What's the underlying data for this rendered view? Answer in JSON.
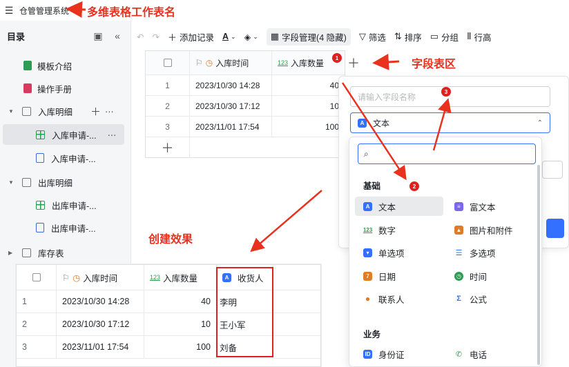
{
  "topbar": {
    "app_title": "仓管管理系统",
    "annotation": "多维表格工作表名"
  },
  "sidebar": {
    "title": "目录",
    "items": [
      {
        "label": "模板介绍"
      },
      {
        "label": "操作手册"
      },
      {
        "label": "入库明细"
      },
      {
        "label": "入库申请-..."
      },
      {
        "label": "入库申请-..."
      },
      {
        "label": "出库明细"
      },
      {
        "label": "出库申请-..."
      },
      {
        "label": "出库申请-..."
      },
      {
        "label": "库存表"
      }
    ]
  },
  "toolbar": {
    "add_record": "添加记录",
    "field_manage": "字段管理(4 隐藏)",
    "filter": "筛选",
    "sort": "排序",
    "group": "分组",
    "row_height": "行高"
  },
  "grid": {
    "headers": [
      "入库时间",
      "入库数量"
    ],
    "rows": [
      {
        "index": "1",
        "time": "2023/10/30 14:28",
        "qty": "40"
      },
      {
        "index": "2",
        "time": "2023/10/30 17:12",
        "qty": "10"
      },
      {
        "index": "3",
        "time": "2023/11/01 17:54",
        "qty": "100"
      }
    ]
  },
  "annotations": {
    "field_area": "字段表区",
    "result": "创建效果"
  },
  "badges": [
    "1",
    "2",
    "3"
  ],
  "panel": {
    "name_placeholder": "请输入字段名称",
    "type_selected": "文本"
  },
  "dropdown": {
    "group_basic": "基础",
    "group_business": "业务",
    "options": [
      {
        "label": "文本",
        "icon": "text-icon",
        "color": "#3370ff"
      },
      {
        "label": "富文本",
        "icon": "richtext-icon",
        "color": "#7b67ee"
      },
      {
        "label": "数字",
        "icon": "number-icon",
        "color": "#2e9c52"
      },
      {
        "label": "图片和附件",
        "icon": "image-icon",
        "color": "#e07b28"
      },
      {
        "label": "单选项",
        "icon": "single-select-icon",
        "color": "#3370ff"
      },
      {
        "label": "多选项",
        "icon": "multi-select-icon",
        "color": "#3370ff"
      },
      {
        "label": "日期",
        "icon": "date-icon",
        "color": "#e07b28"
      },
      {
        "label": "时间",
        "icon": "clock-icon",
        "color": "#2e9c52"
      },
      {
        "label": "联系人",
        "icon": "contact-icon",
        "color": "#e07b28"
      },
      {
        "label": "公式",
        "icon": "formula-icon",
        "color": "#3370ff"
      },
      {
        "label": "身份证",
        "icon": "id-card-icon",
        "color": "#3370ff"
      },
      {
        "label": "电话",
        "icon": "phone-icon",
        "color": "#2e9c52"
      }
    ]
  },
  "result": {
    "headers": [
      "入库时间",
      "入库数量",
      "收货人"
    ],
    "rows": [
      {
        "index": "1",
        "time": "2023/10/30 14:28",
        "qty": "40",
        "person": "李明"
      },
      {
        "index": "2",
        "time": "2023/10/30 17:12",
        "qty": "10",
        "person": "王小军"
      },
      {
        "index": "3",
        "time": "2023/11/01 17:54",
        "qty": "100",
        "person": "刘备"
      }
    ]
  }
}
